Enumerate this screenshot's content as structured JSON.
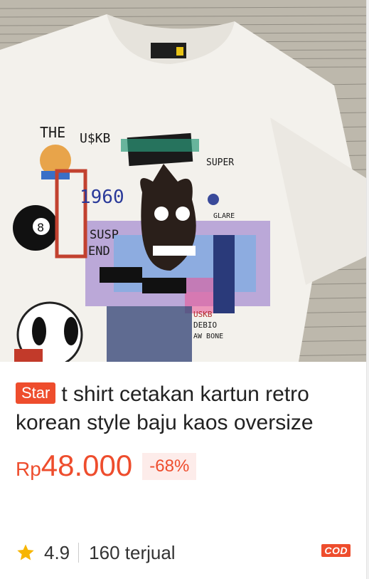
{
  "product": {
    "image_alt": "",
    "print_texts": {
      "the": "THE",
      "brand": "U$KB",
      "super": "SUPER",
      "year": "1960",
      "susp": "SUSP",
      "end": "END",
      "glare": "GLARE",
      "eight": "8",
      "usk": "USKB",
      "debio": "DEBIO",
      "bone": "AW BONE"
    },
    "badge": "Star",
    "title": "t shirt cetakan kartun retro korean style baju kaos oversize",
    "price_currency": "Rp",
    "price_amount": "48.000",
    "discount": "-68%",
    "rating": "4.9",
    "sold": "160 terjual",
    "cod_label": "COD"
  },
  "colors": {
    "accent": "#ee4d2d",
    "discount_bg": "#fdecea",
    "star": "#f7b500"
  },
  "icons": {
    "rating": "star-icon"
  }
}
